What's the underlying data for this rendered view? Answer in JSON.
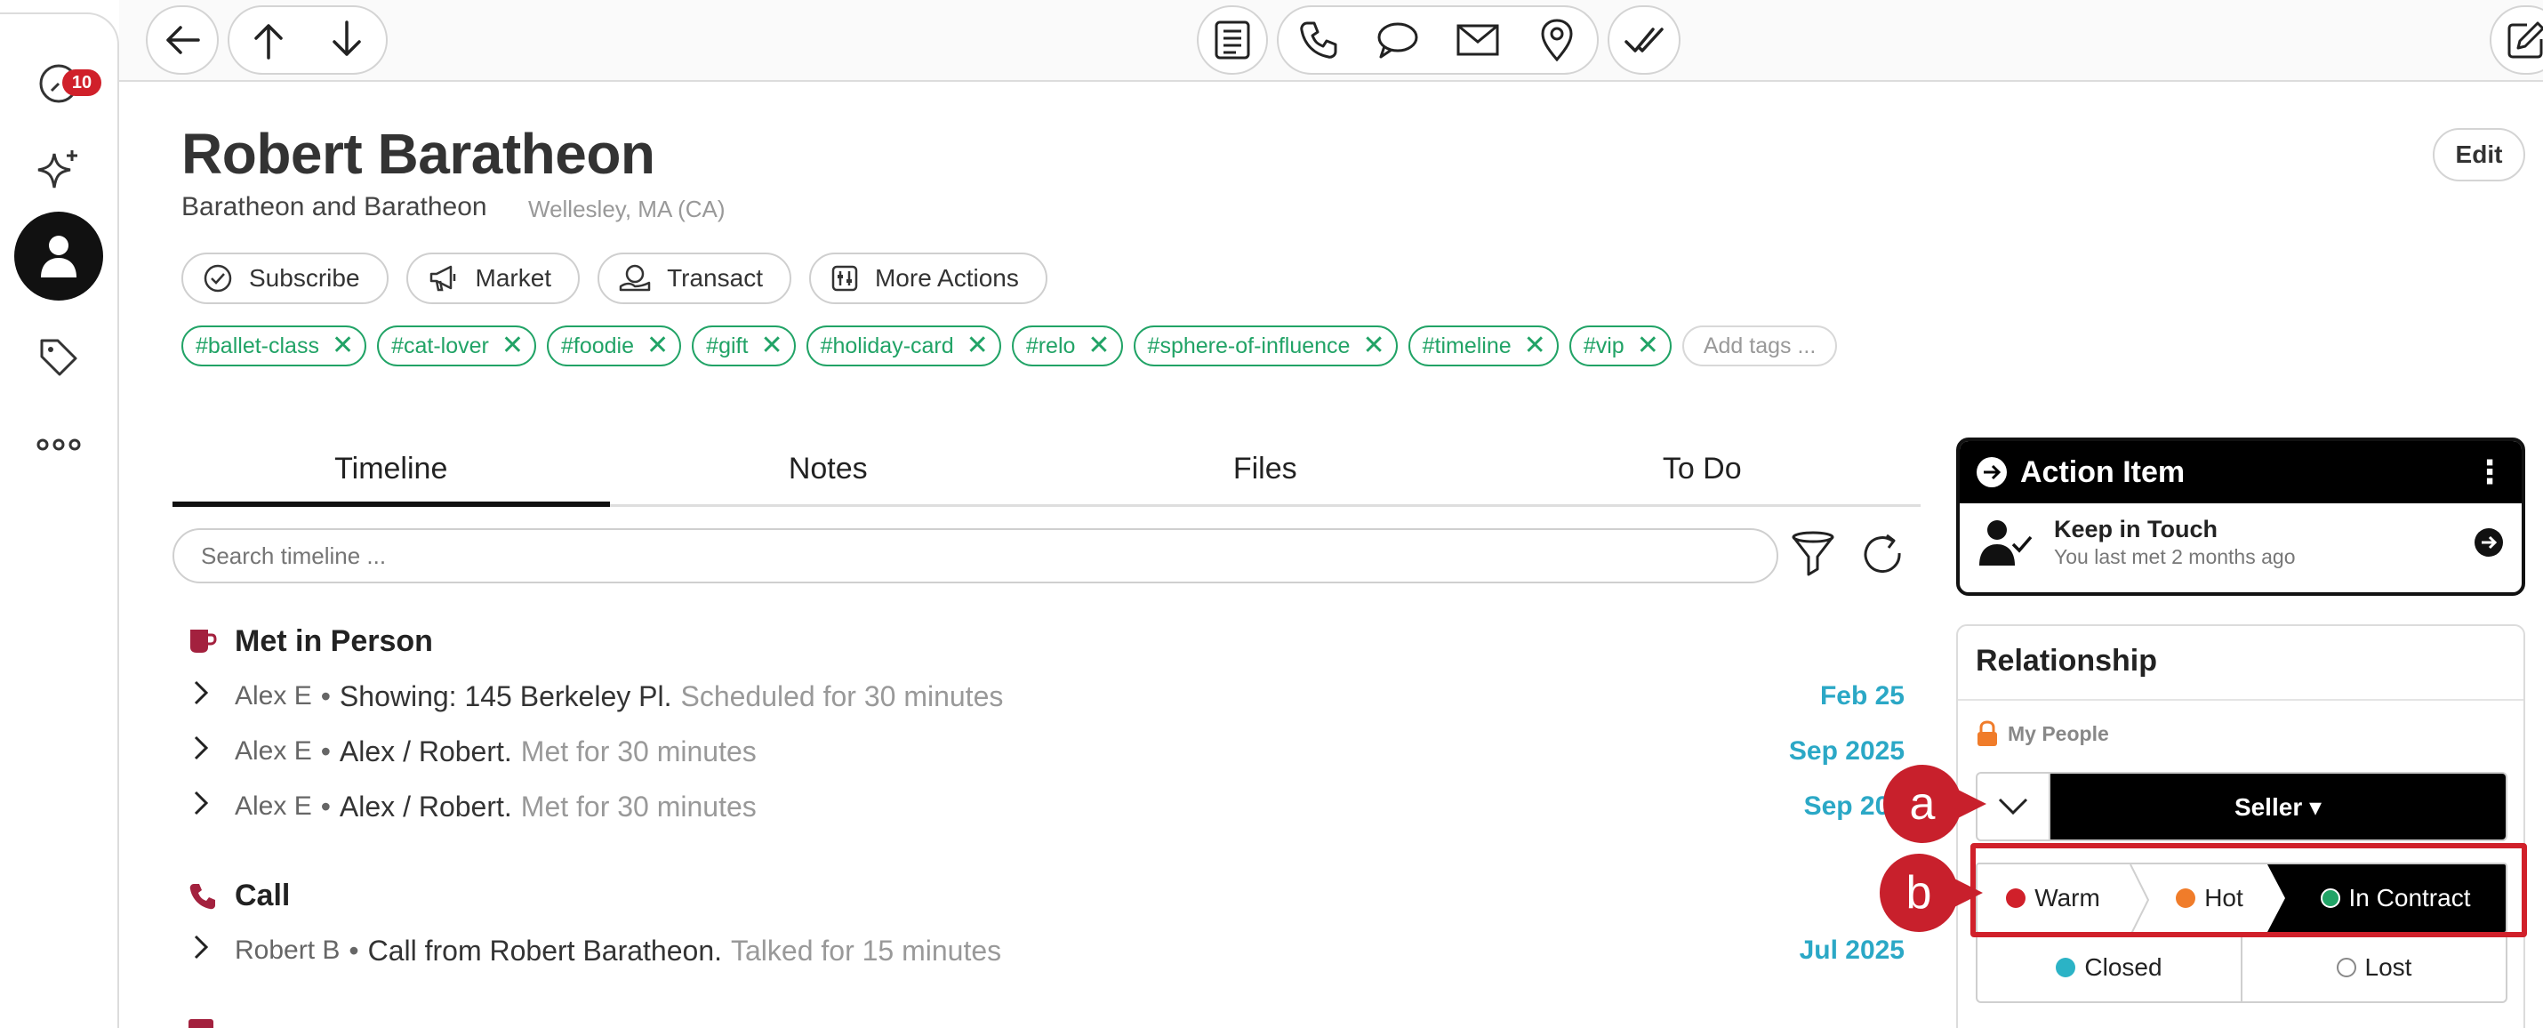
{
  "rail": {
    "notifications_badge": "10",
    "items": [
      "activity-icon",
      "sparkle-icon",
      "person-icon",
      "tag-icon",
      "more-icon"
    ]
  },
  "contact": {
    "name": "Robert Baratheon",
    "company": "Baratheon and Baratheon",
    "location": "Wellesley, MA (CA)",
    "edit_label": "Edit"
  },
  "actions": [
    "Subscribe",
    "Market",
    "Transact",
    "More Actions"
  ],
  "tags": [
    "#ballet-class",
    "#cat-lover",
    "#foodie",
    "#gift",
    "#holiday-card",
    "#relo",
    "#sphere-of-influence",
    "#timeline",
    "#vip"
  ],
  "tags_placeholder": "Add tags ...",
  "tabs": [
    "Timeline",
    "Notes",
    "Files",
    "To Do"
  ],
  "search_placeholder": "Search timeline ...",
  "timeline": {
    "groups": [
      {
        "title": "Met in Person",
        "entries": [
          {
            "author": "Alex E",
            "main": "Showing: 145 Berkeley Pl.",
            "detail": "Scheduled for 30 minutes",
            "date": "Feb 25"
          },
          {
            "author": "Alex E",
            "main": "Alex / Robert.",
            "detail": "Met for 30 minutes",
            "date": "Sep 2025"
          },
          {
            "author": "Alex E",
            "main": "Alex / Robert.",
            "detail": "Met for 30 minutes",
            "date": "Sep 202"
          }
        ]
      },
      {
        "title": "Call",
        "entries": [
          {
            "author": "Robert B",
            "main": "Call from Robert Baratheon.",
            "detail": "Talked for 15 minutes",
            "date": "Jul 2025"
          }
        ]
      }
    ],
    "separator": "•"
  },
  "action_item": {
    "title": "Action Item",
    "item_title": "Keep in Touch",
    "item_sub": "You last met 2 months ago"
  },
  "relationship": {
    "title": "Relationship",
    "group": "My People",
    "role": "Seller ▾",
    "stages": [
      "Warm",
      "Hot",
      "In Contract"
    ],
    "outcomes": [
      "Closed",
      "Lost"
    ],
    "colors": {
      "warm": "#d0202a",
      "hot": "#f07c2a",
      "in_contract": "#21a366",
      "closed": "#2bb3c6"
    }
  },
  "annotations": {
    "a": "a",
    "b": "b"
  }
}
